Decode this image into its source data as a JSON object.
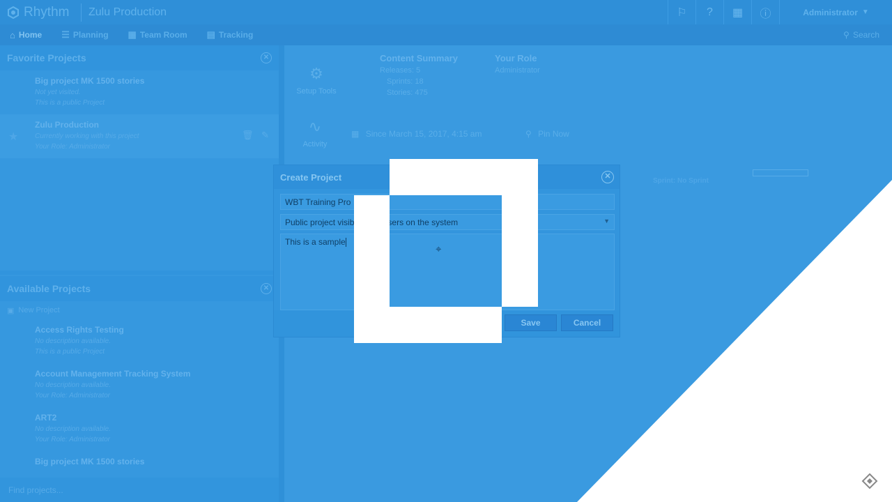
{
  "app": {
    "brand": "Rhythm",
    "project_title": "Zulu Production",
    "admin_label": "Administrator"
  },
  "nav": {
    "items": [
      {
        "label": "Home",
        "icon": "home-icon",
        "active": true
      },
      {
        "label": "Planning",
        "icon": "planning-icon",
        "active": false
      },
      {
        "label": "Team Room",
        "icon": "team-room-icon",
        "active": false
      },
      {
        "label": "Tracking",
        "icon": "tracking-icon",
        "active": false
      }
    ],
    "search_label": "Search"
  },
  "favorites": {
    "title": "Favorite Projects",
    "projects": [
      {
        "name": "Big project MK 1500 stories",
        "desc": "Not yet visited.",
        "role": "This is a public Project",
        "selected": false
      },
      {
        "name": "Zulu Production",
        "desc": "Currently working with this project",
        "role": "Your Role: Administrator",
        "selected": true
      }
    ]
  },
  "available": {
    "title": "Available Projects",
    "new_project": "New Project",
    "projects": [
      {
        "name": "Access Rights Testing",
        "desc": "No description available.",
        "role": "This is a public Project"
      },
      {
        "name": "Account Management Tracking System",
        "desc": "No description available.",
        "role": "Your Role: Administrator"
      },
      {
        "name": "ART2",
        "desc": "No description available.",
        "role": "Your Role: Administrator"
      },
      {
        "name": "Big project MK 1500 stories",
        "desc": "",
        "role": ""
      }
    ],
    "find_placeholder": "Find projects..."
  },
  "main": {
    "tiles": [
      {
        "label": "Setup Tools",
        "icon": "setup-tools-icon"
      },
      {
        "label": "Activity",
        "icon": "activity-icon"
      }
    ],
    "content_summary": {
      "title": "Content Summary",
      "lines": [
        "Releases: 5",
        "Sprints: 18",
        "Stories: 475"
      ]
    },
    "your_role": {
      "title": "Your Role",
      "value": "Administrator"
    },
    "since": "Since March 15, 2017, 4:15 am",
    "pin": "Pin Now",
    "sprint": "Sprint: No Sprint",
    "progress_fraction": 0.0
  },
  "dialog": {
    "title": "Create Project",
    "name_value": "WBT Training Pro",
    "visibility_value": "Public project visible to all users on the system",
    "description_value": "This is a sample",
    "save_label": "Save",
    "cancel_label": "Cancel"
  },
  "colors": {
    "overlay_blue": "#3498e0",
    "white": "#ffffff",
    "text_dark": "#0f3f66"
  }
}
